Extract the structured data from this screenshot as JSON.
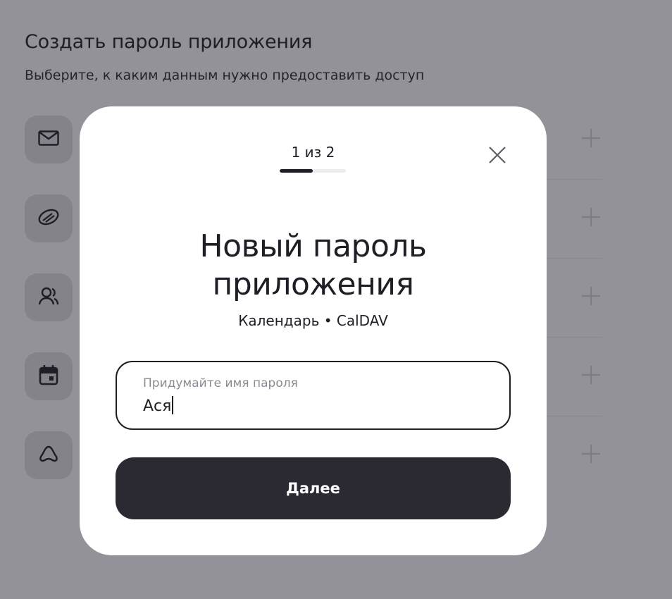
{
  "background_page": {
    "title": "Создать пароль приложения",
    "subtitle": "Выберите, к каким данным нужно предоставить доступ",
    "access_rows": [
      {
        "icon": "mail-icon"
      },
      {
        "icon": "disk-icon"
      },
      {
        "icon": "contacts-icon"
      },
      {
        "icon": "calendar-icon"
      },
      {
        "icon": "cloud-icon"
      }
    ]
  },
  "modal": {
    "step_label": "1 из 2",
    "progress_fraction": 0.5,
    "title_line1": "Новый пароль",
    "title_line2": "приложения",
    "subtitle": "Календарь • CalDAV",
    "field": {
      "label": "Придумайте имя пароля",
      "value": "Ася"
    },
    "next_label": "Далее"
  },
  "colors": {
    "overlay": "#939299",
    "modal_bg": "#ffffff",
    "primary_dark": "#2b2a33",
    "text": "#1f1e26",
    "muted": "#8b8a92"
  }
}
